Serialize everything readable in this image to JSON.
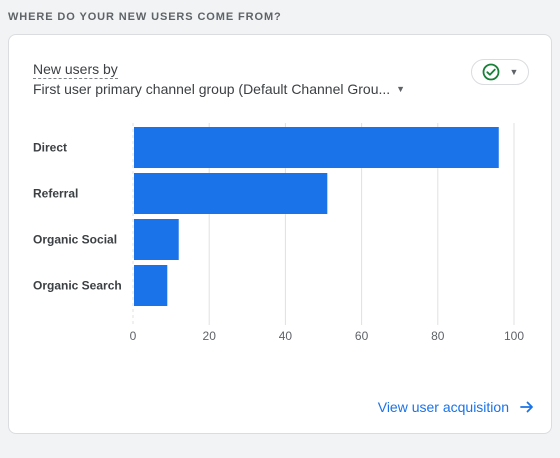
{
  "section": {
    "title": "WHERE DO YOUR NEW USERS COME FROM?"
  },
  "card": {
    "metric_label": "New users by",
    "dimension_label": "First user primary channel group (Default Channel Grou...",
    "status_icon": "check-circle-icon",
    "cta_label": "View user acquisition",
    "cta_icon": "arrow-right-icon"
  },
  "colors": {
    "bar": "#1a73e8",
    "accent": "#1a73e8",
    "status": "#188038",
    "grid": "#e0e0e0"
  },
  "chart_data": {
    "type": "bar",
    "orientation": "horizontal",
    "categories": [
      "Direct",
      "Referral",
      "Organic Social",
      "Organic Search"
    ],
    "values": [
      96,
      51,
      12,
      9
    ],
    "xticks": [
      0,
      20,
      40,
      60,
      80,
      100
    ],
    "xlim": [
      0,
      100
    ],
    "grid": true
  }
}
